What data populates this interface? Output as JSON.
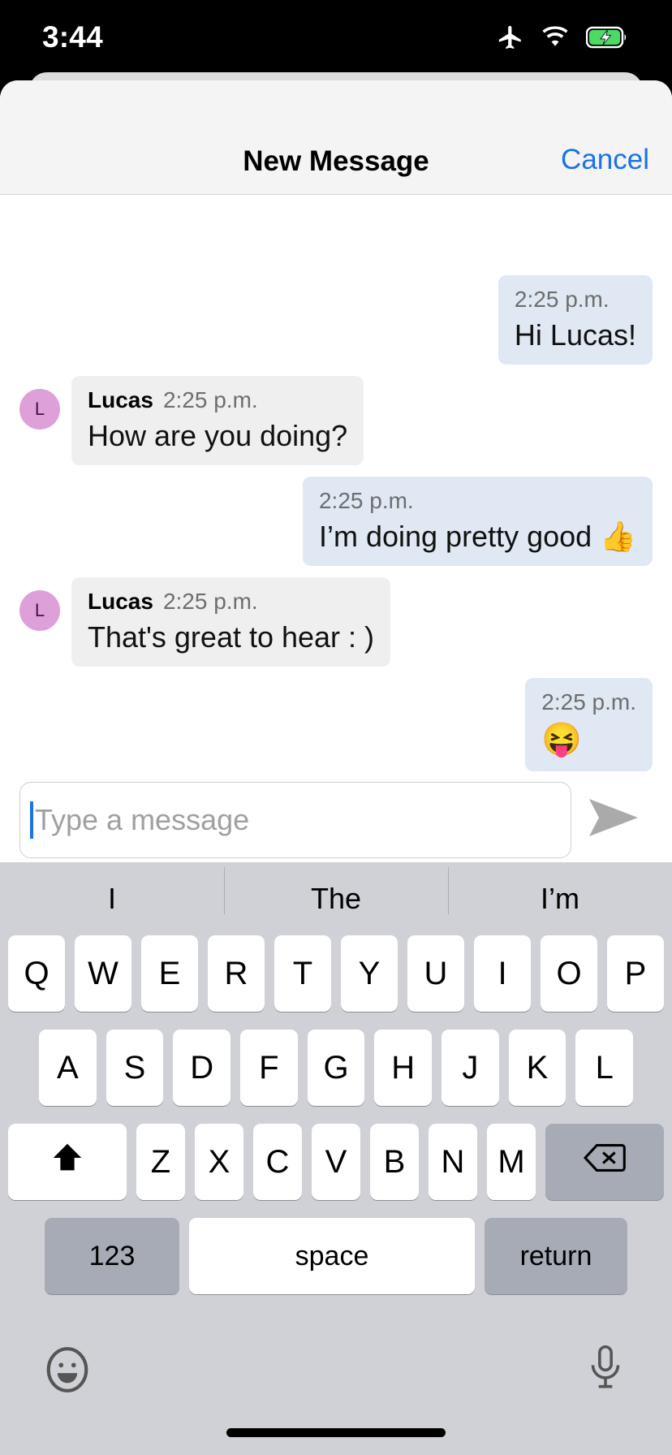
{
  "status_bar": {
    "time": "3:44",
    "icons": [
      "airplane-mode-icon",
      "wifi-icon",
      "battery-charging-icon"
    ],
    "battery_color": "#4cd964"
  },
  "nav": {
    "title": "New Message",
    "cancel_label": "Cancel",
    "accent_color": "#1a73e8"
  },
  "conversation": {
    "messages": [
      {
        "direction": "outgoing",
        "sender": "",
        "time": "2:25 p.m.",
        "text": "Hi Lucas!"
      },
      {
        "direction": "incoming",
        "sender": "Lucas",
        "avatar_initial": "L",
        "time": "2:25 p.m.",
        "text": "How are you doing?"
      },
      {
        "direction": "outgoing",
        "sender": "",
        "time": "2:25 p.m.",
        "text": "I’m doing pretty good 👍"
      },
      {
        "direction": "incoming",
        "sender": "Lucas",
        "avatar_initial": "L",
        "time": "2:25 p.m.",
        "text": "That's great to hear : )"
      },
      {
        "direction": "outgoing",
        "sender": "",
        "time": "2:25 p.m.",
        "text": "😝"
      }
    ],
    "outgoing_bubble_color": "#dfe8f3",
    "incoming_bubble_color": "#efefef",
    "avatar_color": "#dda0d8"
  },
  "composer": {
    "placeholder": "Type a message",
    "value": "",
    "send_icon": "send-arrow-icon"
  },
  "keyboard": {
    "suggestions": [
      "I",
      "The",
      "I’m"
    ],
    "row1": [
      "Q",
      "W",
      "E",
      "R",
      "T",
      "Y",
      "U",
      "I",
      "O",
      "P"
    ],
    "row2": [
      "A",
      "S",
      "D",
      "F",
      "G",
      "H",
      "J",
      "K",
      "L"
    ],
    "row3": [
      "Z",
      "X",
      "C",
      "V",
      "B",
      "N",
      "M"
    ],
    "shift_label": "⬆",
    "backspace_label": "⌫",
    "numbers_label": "123",
    "space_label": "space",
    "return_label": "return",
    "emoji_icon": "smiley-face-icon",
    "mic_icon": "microphone-icon"
  }
}
